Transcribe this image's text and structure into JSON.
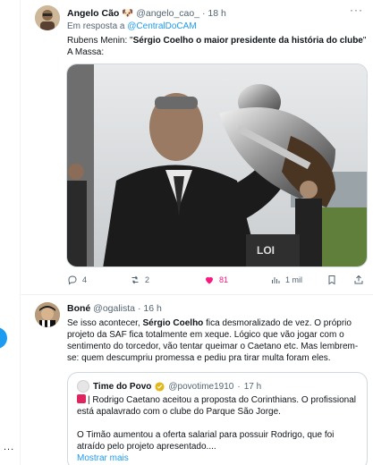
{
  "tweet1": {
    "author_name": "Angelo Cão 🐶",
    "handle": "@angelo_cao_",
    "separator": "·",
    "time": "18 h",
    "reply_prefix": "Em resposta a",
    "reply_handle": "@CentralDoCAM",
    "line1_pre": "Rubens Menin: \"",
    "line1_bold": "Sérgio Coelho o maior presidente da história do clube",
    "line1_post": "\"",
    "line2": "A Massa:",
    "image_alt": "Man in suit lifting a large silver trophy",
    "actions": {
      "replies": "4",
      "retweets": "2",
      "likes": "81",
      "views": "1 mil"
    }
  },
  "tweet2": {
    "author_name": "Boné",
    "handle": "@ogalista",
    "separator": "·",
    "time": "16 h",
    "text_pre": "Se isso acontecer, ",
    "text_bold": "Sérgio Coelho",
    "text_post": " fica desmoralizado de vez. O próprio projeto da SAF fica totalmente em xeque. Lógico que vão jogar com o sentimento do torcedor, vão tentar queimar o Caetano etc. Mas lembrem-se: quem descumpriu promessa e pediu pra tirar multa foram eles.",
    "quote": {
      "author_name": "Time do Povo",
      "handle": "@povotime1910",
      "separator": "·",
      "time": "17 h",
      "p1": "| Rodrigo Caetano aceitou a proposta do Corinthians. O profissional está apalavrado com o clube do Parque São Jorge.",
      "p2": "O Timão aumentou a oferta salarial para possuir Rodrigo, que foi atraído pelo projeto apresentado....",
      "show_more": "Mostrar mais"
    }
  },
  "icons": {
    "reply": "reply-icon",
    "retweet": "retweet-icon",
    "like": "heart-icon",
    "views": "views-icon",
    "bookmark": "bookmark-icon",
    "share": "share-icon",
    "more": "more-icon",
    "verified": "verified-badge-icon"
  },
  "colors": {
    "accent": "#1d9bf0",
    "like": "#f91880",
    "muted": "#536471",
    "verified_gold": "#e2b719"
  },
  "rail": {
    "more": "..."
  }
}
